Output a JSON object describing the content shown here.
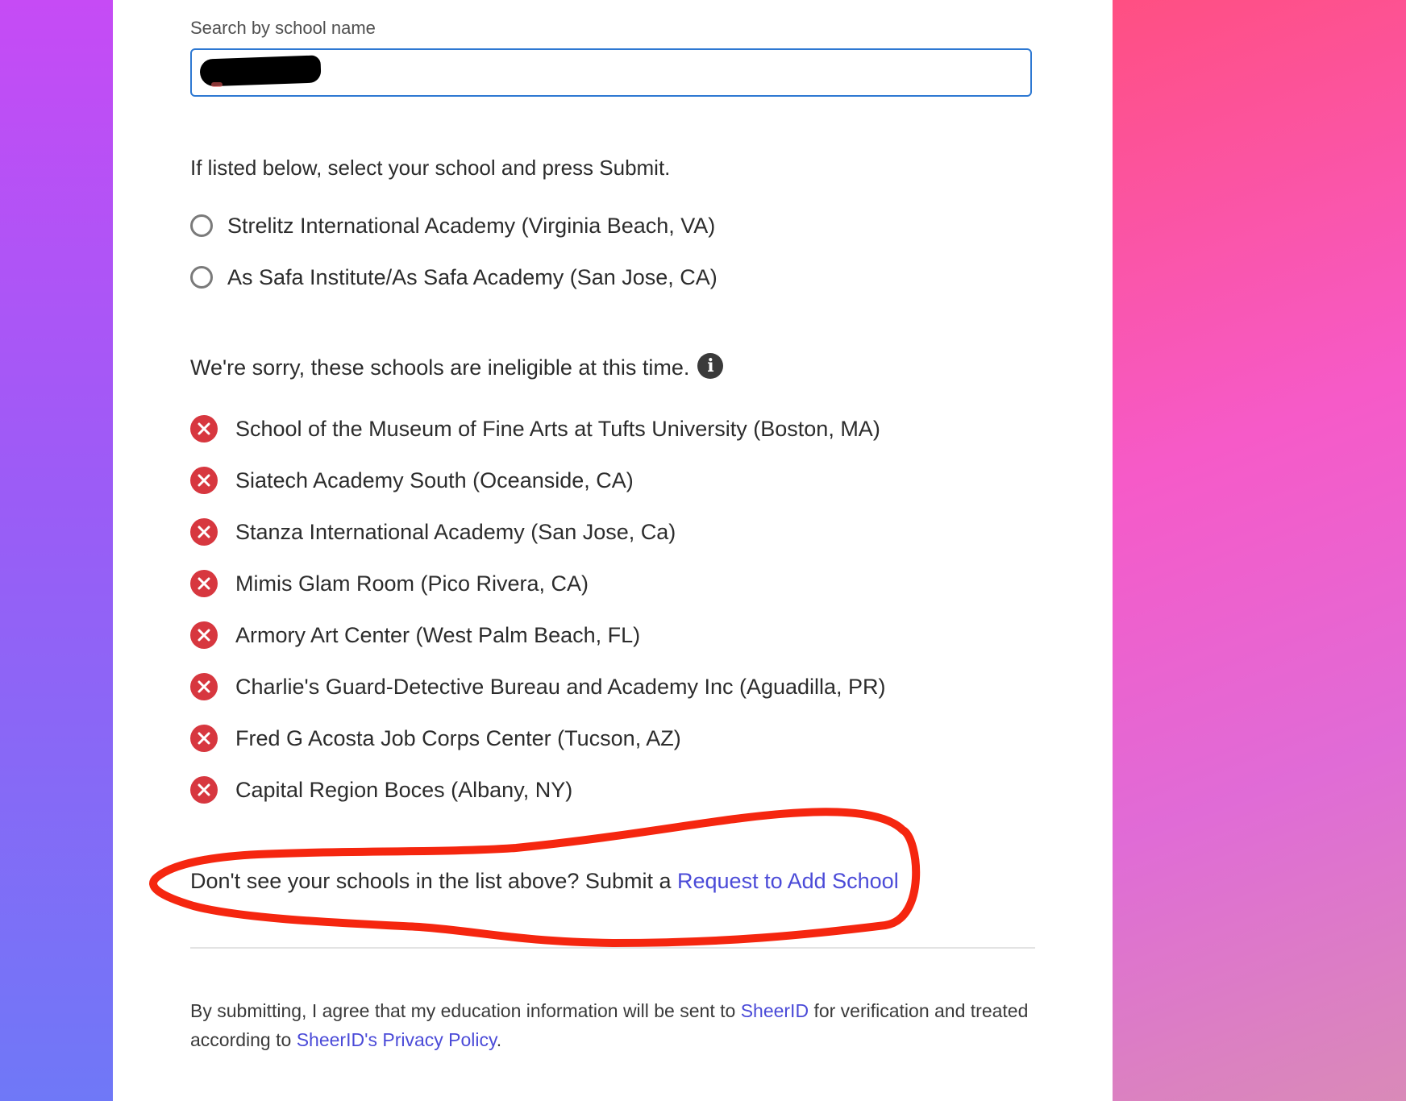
{
  "search": {
    "label": "Search by school name",
    "value": ""
  },
  "eligible": {
    "prompt": "If listed below, select your school and press Submit.",
    "schools": [
      "Strelitz International Academy (Virginia Beach, VA)",
      "As Safa Institute/As Safa Academy (San Jose, CA)"
    ]
  },
  "ineligible": {
    "heading": "We're sorry, these schools are ineligible at this time.",
    "info_icon": "i",
    "schools": [
      "School of the Museum of Fine Arts at Tufts University (Boston, MA)",
      "Siatech Academy South (Oceanside, CA)",
      "Stanza International Academy (San Jose, Ca)",
      "Mimis Glam Room (Pico Rivera, CA)",
      "Armory Art Center (West Palm Beach, FL)",
      "Charlie's Guard-Detective Bureau and Academy Inc (Aguadilla, PR)",
      "Fred G Acosta Job Corps Center (Tucson, AZ)",
      "Capital Region Boces (Albany, NY)"
    ]
  },
  "request": {
    "text": "Don't see your schools in the list above? Submit a",
    "link": "Request to Add School"
  },
  "legal": {
    "part1": "By submitting, I agree that my education information will be sent to",
    "sheerid_link": "SheerID",
    "part2": "for verification and treated according to",
    "privacy_link": "SheerID's Privacy Policy",
    "part3": "."
  },
  "colors": {
    "accent": "#2d78d2",
    "link": "#4b4bd8",
    "error": "#d7373f",
    "annotation": "#f5260f"
  }
}
